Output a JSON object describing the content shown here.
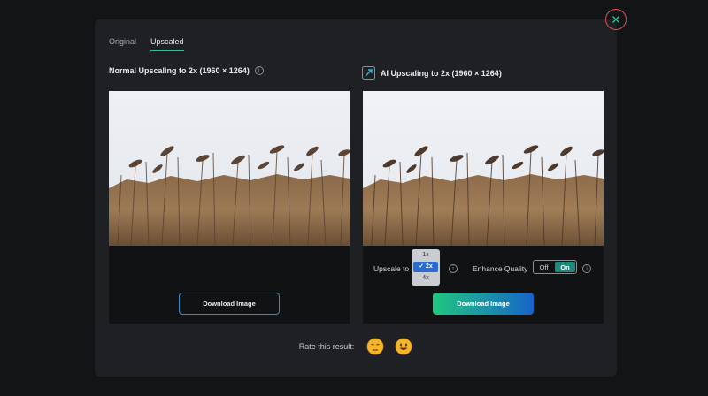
{
  "tabs": [
    "Original",
    "Upscaled"
  ],
  "left_panel": {
    "title": "Normal Upscaling to 2x (1960 × 1264)",
    "download_label": "Download Image"
  },
  "right_panel": {
    "title": "AI Upscaling to 2x (1960 × 1264)",
    "upscale_label": "Upscale to",
    "upscale_options": [
      "1x",
      "✓ 2x",
      "4x"
    ],
    "enhance_label": "Enhance Quality",
    "toggle_off": "Off",
    "toggle_on": "On",
    "download_label": "Download Image"
  },
  "rating": {
    "label": "Rate this result:"
  },
  "colors": {
    "accent_green": "#27c493",
    "accent_blue": "#1764c9",
    "close_red": "#e05050"
  },
  "icons": [
    "close-icon",
    "info-icon",
    "ai-upscale-icon",
    "sad-face-icon",
    "happy-face-icon"
  ]
}
